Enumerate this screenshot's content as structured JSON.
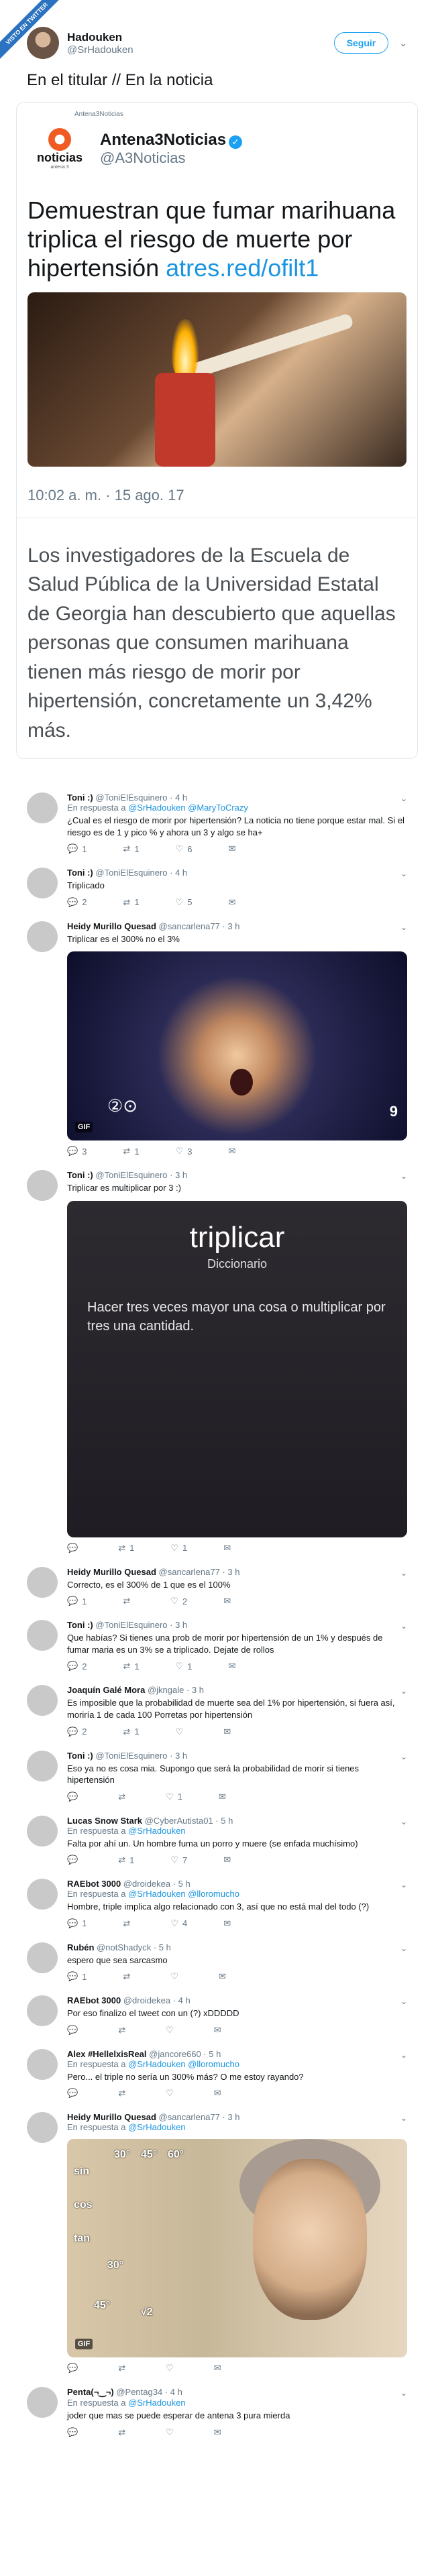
{
  "ribbon": "VISTO EN TWITTER",
  "author": {
    "name": "Hadouken",
    "handle": "@SrHadouken",
    "follow_label": "Seguir",
    "text": "En el titular // En la noticia"
  },
  "quoted": {
    "small_label": "Antena3Noticias",
    "logo_text": "noticias",
    "logo_sub": "antena 3",
    "name": "Antena3Noticias",
    "handle": "@A3Noticias",
    "headline": "Demuestran que fumar marihuana triplica el riesgo de muerte por hipertensión",
    "link": "atres.red/ofilt1",
    "date": "10:02 a. m. · 15 ago. 17",
    "body": "Los investigadores de la Escuela de Salud Pública de la Universidad Estatal de Georgia han descubierto que aquellas personas que consumen marihuana tienen más riesgo de morir por hipertensión, concretamente un 3,42% más."
  },
  "replies": [
    {
      "name": "Toni :)",
      "handle": "@ToniElEsquinero · 4 h",
      "to_prefix": "En respuesta a",
      "to": "@SrHadouken @MaryToCrazy",
      "text": "¿Cual es el riesgo de morir por hipertensión? La noticia no tiene porque estar mal. Si el riesgo es de 1 y pico % y ahora un 3 y algo se ha+",
      "counts": [
        "1",
        "1",
        "6"
      ]
    },
    {
      "name": "Toni :)",
      "handle": "@ToniElEsquinero · 4 h",
      "to_prefix": "",
      "to": "",
      "text": "Triplicado",
      "counts": [
        "2",
        "1",
        "5"
      ]
    },
    {
      "name": "Heidy Murillo Quesad",
      "handle": "@sancarlena77 · 3 h",
      "to_prefix": "",
      "to": "",
      "text": "Triplicar es el 300% no el 3%",
      "counts": [
        "3",
        "1",
        "3"
      ],
      "media": "gif1",
      "gif_label": "GIF",
      "channel": "9"
    },
    {
      "name": "Toni :)",
      "handle": "@ToniElEsquinero · 3 h",
      "to_prefix": "",
      "to": "",
      "text": "Triplicar es multiplicar por 3 :)",
      "counts": [
        "",
        "1",
        "1"
      ],
      "media": "dict",
      "dict_word": "triplicar",
      "dict_label": "Diccionario",
      "dict_def": "Hacer tres veces mayor una cosa o multiplicar por tres una cantidad."
    },
    {
      "name": "Heidy Murillo Quesad",
      "handle": "@sancarlena77 · 3 h",
      "to_prefix": "",
      "to": "",
      "text": "Correcto, es el 300% de 1 que es el 100%",
      "counts": [
        "1",
        "",
        "2"
      ]
    },
    {
      "name": "Toni :)",
      "handle": "@ToniElEsquinero · 3 h",
      "to_prefix": "",
      "to": "",
      "text": "Que habías? Si tienes una prob de morir por hipertensión de un 1% y después de fumar maria es un 3% se a triplicado. Dejate de rollos",
      "counts": [
        "2",
        "1",
        "1"
      ]
    },
    {
      "name": "Joaquín Galé Mora",
      "handle": "@jkngale · 3 h",
      "to_prefix": "",
      "to": "",
      "text": "Es imposible que la probabilidad de muerte sea del 1% por hipertensión, si fuera así, moriría 1 de cada 100 Porretas por hipertensión",
      "counts": [
        "2",
        "1",
        ""
      ]
    },
    {
      "name": "Toni :)",
      "handle": "@ToniElEsquinero · 3 h",
      "to_prefix": "",
      "to": "",
      "text": "Eso ya no es cosa mia. Supongo que será la probabilidad de morir si tienes hipertensión",
      "counts": [
        "",
        "",
        "1"
      ]
    },
    {
      "name": "Lucas Snow Stark",
      "handle": "@CyberAutista01 · 5 h",
      "to_prefix": "En respuesta a",
      "to": "@SrHadouken",
      "text": "Falta por ahí un. Un hombre fuma un porro y muere (se enfada muchísimo)",
      "counts": [
        "",
        "1",
        "7"
      ]
    },
    {
      "name": "RAEbot 3000",
      "handle": "@droidekea · 5 h",
      "to_prefix": "En respuesta a",
      "to": "@SrHadouken @lloromucho",
      "text": "Hombre, triple implica algo relacionado con 3, así que no está mal del todo (?)",
      "counts": [
        "1",
        "",
        "4"
      ]
    },
    {
      "name": "Rubén",
      "handle": "@notShadyck · 5 h",
      "to_prefix": "",
      "to": "",
      "text": "espero que sea sarcasmo",
      "counts": [
        "1",
        "",
        ""
      ]
    },
    {
      "name": "RAEbot 3000",
      "handle": "@droidekea · 4 h",
      "to_prefix": "",
      "to": "",
      "text": "Por eso finalizo el tweet con un (?) xDDDDD",
      "counts": [
        "",
        "",
        ""
      ]
    },
    {
      "name": "Alex #HellelxisReal",
      "handle": "@jancore660 · 5 h",
      "to_prefix": "En respuesta a",
      "to": "@SrHadouken @lloromucho",
      "text": "Pero... el triple no sería un 300% más? O me estoy rayando?",
      "counts": [
        "",
        "",
        ""
      ]
    },
    {
      "name": "Heidy Murillo Quesad",
      "handle": "@sancarlena77 · 3 h",
      "to_prefix": "En respuesta a",
      "to": "@SrHadouken",
      "text": "",
      "counts": [
        "",
        "",
        ""
      ],
      "media": "gif2",
      "gif_label": "GIF"
    },
    {
      "name": "Penta(¬‿¬)",
      "handle": "@Pentag34 · 4 h",
      "to_prefix": "En respuesta a",
      "to": "@SrHadouken",
      "text": "joder que mas se puede esperar de antena 3 pura mierda",
      "counts": [
        "",
        "",
        ""
      ]
    }
  ]
}
